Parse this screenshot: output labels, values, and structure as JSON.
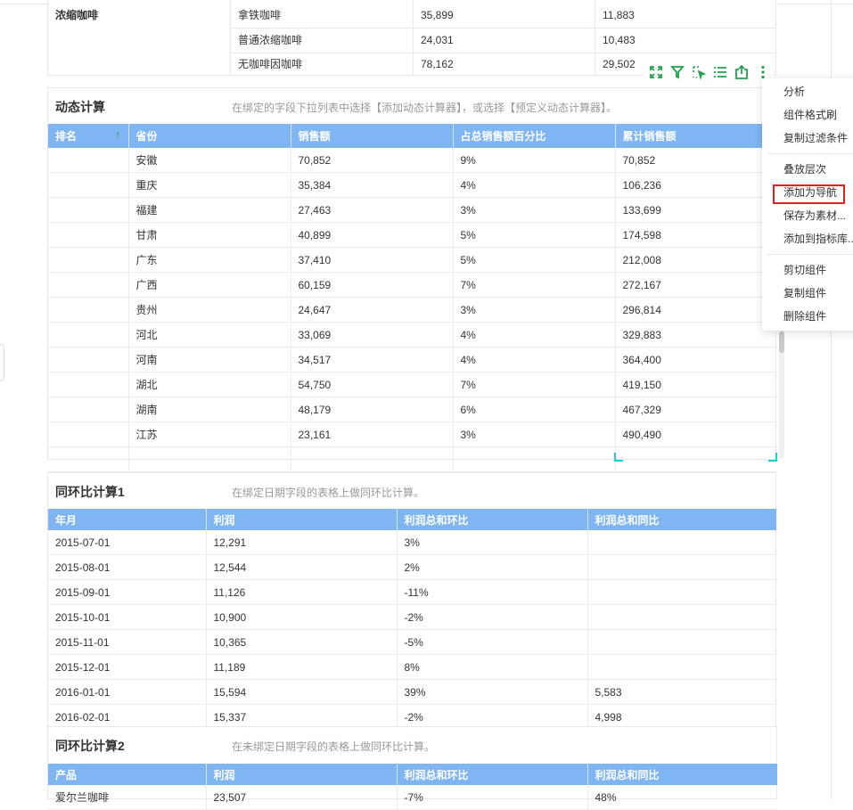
{
  "coffee": {
    "group": "浓缩咖啡",
    "rows": [
      {
        "product": "拿铁咖啡",
        "v1": "35,899",
        "v2": "11,883"
      },
      {
        "product": "普通浓缩咖啡",
        "v1": "24,031",
        "v2": "10,483"
      },
      {
        "product": "无咖啡因咖啡",
        "v1": "78,162",
        "v2": "29,502"
      }
    ]
  },
  "dyn": {
    "title": "动态计算",
    "desc": "在绑定的字段下拉列表中选择【添加动态计算器】，或选择【预定义动态计算器】。",
    "headers": {
      "rank": "排名",
      "rank_arrow": "↑",
      "province": "省份",
      "sales": "销售额",
      "pct": "占总销售额百分比",
      "cum": "累计销售额"
    },
    "rows": [
      {
        "rank": "",
        "province": "安徽",
        "sales": "70,852",
        "pct": "9%",
        "cum": "70,852"
      },
      {
        "rank": "",
        "province": "重庆",
        "sales": "35,384",
        "pct": "4%",
        "cum": "106,236"
      },
      {
        "rank": "",
        "province": "福建",
        "sales": "27,463",
        "pct": "3%",
        "cum": "133,699"
      },
      {
        "rank": "",
        "province": "甘肃",
        "sales": "40,899",
        "pct": "5%",
        "cum": "174,598"
      },
      {
        "rank": "",
        "province": "广东",
        "sales": "37,410",
        "pct": "5%",
        "cum": "212,008"
      },
      {
        "rank": "",
        "province": "广西",
        "sales": "60,159",
        "pct": "7%",
        "cum": "272,167"
      },
      {
        "rank": "",
        "province": "贵州",
        "sales": "24,647",
        "pct": "3%",
        "cum": "296,814"
      },
      {
        "rank": "",
        "province": "河北",
        "sales": "33,069",
        "pct": "4%",
        "cum": "329,883"
      },
      {
        "rank": "",
        "province": "河南",
        "sales": "34,517",
        "pct": "4%",
        "cum": "364,400"
      },
      {
        "rank": "",
        "province": "湖北",
        "sales": "54,750",
        "pct": "7%",
        "cum": "419,150"
      },
      {
        "rank": "",
        "province": "湖南",
        "sales": "48,179",
        "pct": "6%",
        "cum": "467,329"
      },
      {
        "rank": "",
        "province": "江苏",
        "sales": "23,161",
        "pct": "3%",
        "cum": "490,490"
      }
    ]
  },
  "yoy1": {
    "title": "同环比计算1",
    "desc": "在绑定日期字段的表格上做同环比计算。",
    "headers": {
      "month": "年月",
      "profit": "利润",
      "mom": "利润总和环比",
      "yoy": "利润总和同比"
    },
    "rows": [
      {
        "month": "2015-07-01",
        "profit": "12,291",
        "mom": "3%",
        "yoy": ""
      },
      {
        "month": "2015-08-01",
        "profit": "12,544",
        "mom": "2%",
        "yoy": ""
      },
      {
        "month": "2015-09-01",
        "profit": "11,126",
        "mom": "-11%",
        "yoy": ""
      },
      {
        "month": "2015-10-01",
        "profit": "10,900",
        "mom": "-2%",
        "yoy": ""
      },
      {
        "month": "2015-11-01",
        "profit": "10,365",
        "mom": "-5%",
        "yoy": ""
      },
      {
        "month": "2015-12-01",
        "profit": "11,189",
        "mom": "8%",
        "yoy": ""
      },
      {
        "month": "2016-01-01",
        "profit": "15,594",
        "mom": "39%",
        "yoy": "5,583"
      },
      {
        "month": "2016-02-01",
        "profit": "15,337",
        "mom": "-2%",
        "yoy": "4,998"
      }
    ]
  },
  "yoy2": {
    "title": "同环比计算2",
    "desc": "在未绑定日期字段的表格上做同环比计算。",
    "headers": {
      "product": "产品",
      "profit": "利润",
      "mom": "利润总和环比",
      "yoy": "利润总和同比"
    },
    "rows": [
      {
        "product": "爱尔兰咖啡",
        "profit": "23,507",
        "mom": "-7%",
        "yoy": "48%"
      }
    ]
  },
  "toolbar": {
    "icons": [
      "fullscreen-icon",
      "filter-icon",
      "select-icon",
      "list-icon",
      "export-icon",
      "more-icon"
    ],
    "accent": "#1ea24a"
  },
  "menu": {
    "analyze": "分析",
    "format_brush": "组件格式刷",
    "copy_filter": "复制过滤条件",
    "layer": "叠放层次",
    "add_nav": "添加为导航",
    "save_material": "保存为素材...",
    "add_metric": "添加到指标库...",
    "cut": "剪切组件",
    "copy": "复制组件",
    "delete": "删除组件"
  },
  "colors": {
    "header": "#7fb5f3",
    "highlight_border": "#e02020",
    "selection": "#1ad1ce"
  }
}
